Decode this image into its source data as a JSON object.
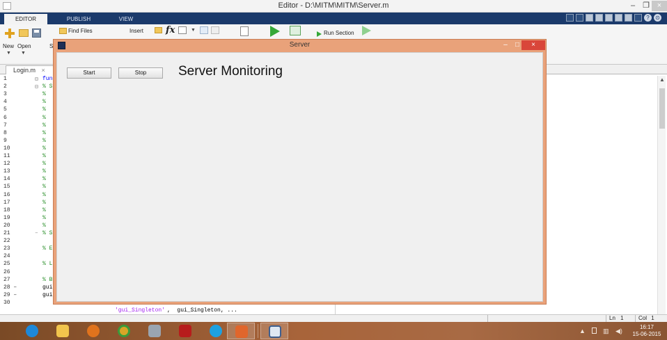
{
  "window": {
    "title": "Editor - D:\\MITM\\MITM\\Server.m",
    "controls": [
      "–",
      "❐",
      "×"
    ]
  },
  "ribbon": {
    "tabs": [
      "EDITOR",
      "PUBLISH",
      "VIEW"
    ],
    "active_tab": "EDITOR"
  },
  "toolstrip": {
    "new_label": "New",
    "open_label": "Open",
    "save_label_partial": "S",
    "find_files_label": "Find Files",
    "insert_label": "Insert",
    "fx_label": "fx",
    "run_section_label": "Run Section"
  },
  "editor": {
    "file_tab": "Login.m",
    "file_tab_close": "×",
    "line_numbers": [
      "1",
      "2",
      "3",
      "4",
      "5",
      "6",
      "7",
      "8",
      "9",
      "10",
      "11",
      "12",
      "13",
      "14",
      "15",
      "16",
      "17",
      "18",
      "19",
      "20",
      "21",
      "22",
      "23",
      "24",
      "25",
      "26",
      "27",
      "28 –",
      "29 –",
      "30"
    ],
    "code_lines": [
      {
        "text": "fun",
        "kind": "kw"
      },
      {
        "text": "% S",
        "kind": "cmt"
      },
      {
        "text": "%",
        "kind": "cmt"
      },
      {
        "text": "%",
        "kind": "cmt"
      },
      {
        "text": "%",
        "kind": "cmt"
      },
      {
        "text": "%",
        "kind": "cmt"
      },
      {
        "text": "%",
        "kind": "cmt"
      },
      {
        "text": "%",
        "kind": "cmt"
      },
      {
        "text": "%",
        "kind": "cmt"
      },
      {
        "text": "%",
        "kind": "cmt"
      },
      {
        "text": "%",
        "kind": "cmt"
      },
      {
        "text": "%",
        "kind": "cmt"
      },
      {
        "text": "%",
        "kind": "cmt"
      },
      {
        "text": "%",
        "kind": "cmt"
      },
      {
        "text": "%",
        "kind": "cmt"
      },
      {
        "text": "%",
        "kind": "cmt"
      },
      {
        "text": "%",
        "kind": "cmt"
      },
      {
        "text": "%",
        "kind": "cmt"
      },
      {
        "text": "%",
        "kind": "cmt"
      },
      {
        "text": "%",
        "kind": "cmt"
      },
      {
        "text": "% S",
        "kind": "cmt"
      },
      {
        "text": "",
        "kind": "plain"
      },
      {
        "text": "% E",
        "kind": "cmt"
      },
      {
        "text": "",
        "kind": "plain"
      },
      {
        "text": "% L",
        "kind": "cmt"
      },
      {
        "text": "",
        "kind": "plain"
      },
      {
        "text": "% B",
        "kind": "cmt"
      },
      {
        "text": "gui",
        "kind": "plain"
      },
      {
        "text": "gui",
        "kind": "plain"
      },
      {
        "text": "",
        "kind": "plain"
      }
    ],
    "line30_string": "'gui_Singleton'",
    "line30_rest": ",  gui_Singleton, ..."
  },
  "statusbar": {
    "ln_label": "Ln",
    "ln_value": "1",
    "col_label": "Col",
    "col_value": "1"
  },
  "figure": {
    "title": "Server",
    "controls": [
      "–",
      "□",
      "×"
    ],
    "start_button": "Start",
    "stop_button": "Stop",
    "heading": "Server Monitoring"
  },
  "taskbar": {
    "apps": [
      "internet-explorer-icon",
      "file-explorer-icon",
      "firefox-icon",
      "chrome-icon",
      "remote-icon",
      "filezilla-icon",
      "skype-icon",
      "matlab-icon",
      "window-preview-icon"
    ],
    "tray_arrow": "▲",
    "time": "16:17",
    "date": "15-06-2015"
  },
  "colors": {
    "ribbon_bar": "#1b3a6b",
    "figure_frame": "#e9a27a",
    "figure_close": "#d9463a",
    "taskbar": "#a8643a",
    "comment_green": "#228b22",
    "keyword_blue": "#0000ff",
    "string_purple": "#a020f0"
  }
}
